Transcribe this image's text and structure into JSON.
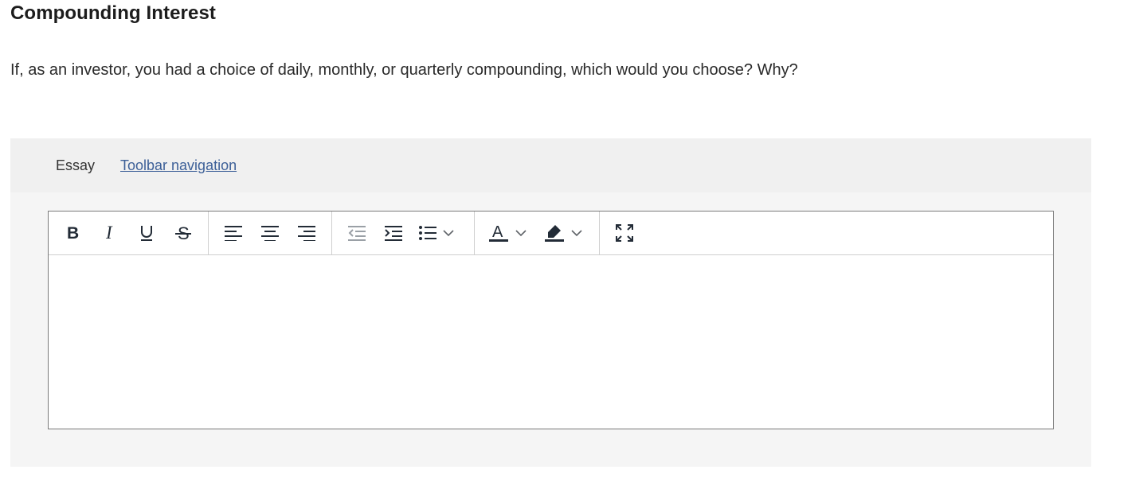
{
  "page": {
    "title": "Compounding Interest",
    "question": "If, as an investor, you had a choice of daily, monthly, or quarterly compounding, which would you choose? Why?"
  },
  "essay": {
    "label": "Essay",
    "toolbar_link": "Toolbar navigation ",
    "content": ""
  },
  "toolbar": {
    "buttons": [
      {
        "name": "bold-button",
        "icon": "bold-icon"
      },
      {
        "name": "italic-button",
        "icon": "italic-icon"
      },
      {
        "name": "underline-button",
        "icon": "underline-icon"
      },
      {
        "name": "strikethrough-button",
        "icon": "strikethrough-icon"
      },
      {
        "name": "align-left-button",
        "icon": "align-left-icon"
      },
      {
        "name": "align-center-button",
        "icon": "align-center-icon"
      },
      {
        "name": "align-right-button",
        "icon": "align-right-icon"
      },
      {
        "name": "outdent-button",
        "icon": "outdent-icon"
      },
      {
        "name": "indent-button",
        "icon": "indent-icon"
      },
      {
        "name": "bullet-list-button",
        "icon": "bullet-list-icon"
      },
      {
        "name": "text-color-button",
        "icon": "text-color-icon"
      },
      {
        "name": "highlight-color-button",
        "icon": "highlighter-icon"
      },
      {
        "name": "fullscreen-button",
        "icon": "fullscreen-icon"
      }
    ],
    "colors": {
      "icon": "#222b36",
      "disabled_icon": "#9aa0a6",
      "link": "#3d6098"
    }
  }
}
